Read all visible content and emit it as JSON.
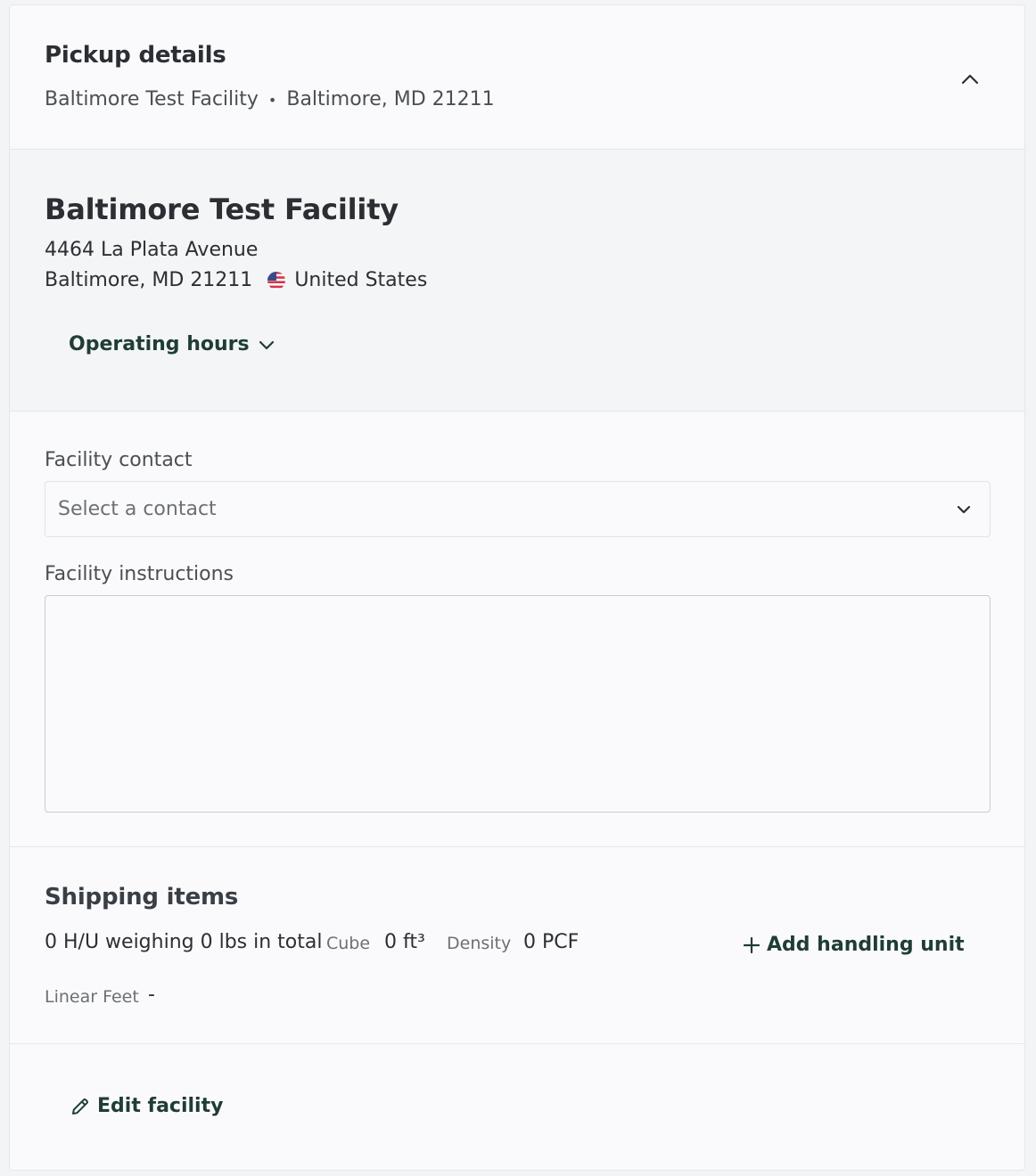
{
  "header": {
    "title": "Pickup details",
    "facility": "Baltimore Test Facility",
    "separator": "•",
    "location": "Baltimore, MD 21211"
  },
  "facility": {
    "name": "Baltimore Test Facility",
    "street": "4464 La Plata Avenue",
    "city_state_zip": "Baltimore, MD 21211",
    "country": "United States",
    "operating_hours_label": "Operating hours"
  },
  "contact": {
    "label": "Facility contact",
    "placeholder": "Select a contact"
  },
  "instructions": {
    "label": "Facility instructions",
    "value": ""
  },
  "shipping": {
    "title": "Shipping items",
    "summary": "0 H/U weighing 0 lbs in total",
    "cube_label": "Cube",
    "cube_value": "0 ft³",
    "density_label": "Density",
    "density_value": "0 PCF",
    "linear_feet_label": "Linear Feet",
    "linear_feet_value": "-",
    "add_label": "Add handling unit"
  },
  "footer": {
    "edit_label": "Edit facility"
  },
  "colors": {
    "accent": "#1f3d35",
    "text": "#2b2f33",
    "muted": "#6b7076",
    "border": "#e6e7ea"
  },
  "icons": {
    "collapse": "chevron-up-icon",
    "hours": "chevron-down-icon",
    "select": "chevron-down-icon",
    "flag": "us-flag-icon",
    "add": "plus-icon",
    "edit": "pencil-icon"
  }
}
